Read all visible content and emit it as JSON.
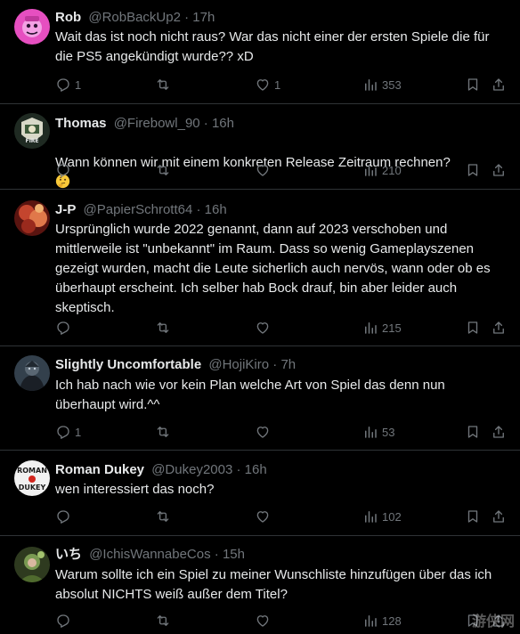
{
  "colors": {
    "background": "#000000",
    "text": "#e7e9ea",
    "muted": "#71767b",
    "divider": "#2f3336"
  },
  "icons": [
    "reply-icon",
    "retweet-icon",
    "like-icon",
    "views-icon",
    "bookmark-icon",
    "share-icon",
    "thinking-emoji-icon"
  ],
  "tweets": [
    {
      "name": "Rob",
      "handle": "@RobBackUp2",
      "sep": "·",
      "time": "17h",
      "text": "Wait das ist noch nicht raus? War das nicht einer der ersten Spiele die für die PS5 angekündigt wurde?? xD",
      "replies": "1",
      "retweets": "",
      "likes": "1",
      "views": "353"
    },
    {
      "name": "Thomas",
      "handle": "@Firebowl_90",
      "sep": "·",
      "time": "16h",
      "text": "Wann können wir mit einem konkreten Release Zeitraum rechnen?",
      "replies": "",
      "retweets": "",
      "likes": "",
      "views": "210"
    },
    {
      "name": "J-P",
      "handle": "@PapierSchrott64",
      "sep": "·",
      "time": "16h",
      "text": "Ursprünglich wurde 2022 genannt, dann auf 2023 verschoben und mittlerweile ist \"unbekannt\" im Raum. Dass so wenig Gameplayszenen gezeigt wurden, macht die Leute sicherlich auch nervös, wann oder ob es überhaupt erscheint. Ich selber hab Bock drauf, bin aber leider auch skeptisch.",
      "replies": "",
      "retweets": "",
      "likes": "",
      "views": "215"
    },
    {
      "name": "Slightly Uncomfortable",
      "handle": "@HojiKiro",
      "sep": "·",
      "time": "7h",
      "text": "Ich hab nach wie vor kein Plan welche Art von Spiel das denn nun überhaupt wird.^^",
      "replies": "1",
      "retweets": "",
      "likes": "",
      "views": "53"
    },
    {
      "name": "Roman Dukey",
      "handle": "@Dukey2003",
      "sep": "·",
      "time": "16h",
      "text": "wen interessiert das noch?",
      "replies": "",
      "retweets": "",
      "likes": "",
      "views": "102"
    },
    {
      "name": "いち",
      "handle": "@IchisWannabeCos",
      "sep": "·",
      "time": "15h",
      "text": "Warum sollte ich ein Spiel zu meiner Wunschliste hinzufügen über das ich absolut NICHTS weiß außer dem Titel?",
      "replies": "",
      "retweets": "",
      "likes": "",
      "views": "128"
    }
  ],
  "avatars": {
    "roman_text_top": "ROMAN",
    "roman_text_bottom": "DUKEY",
    "thomas_text": "FIRE"
  },
  "watermark": "游侠网"
}
